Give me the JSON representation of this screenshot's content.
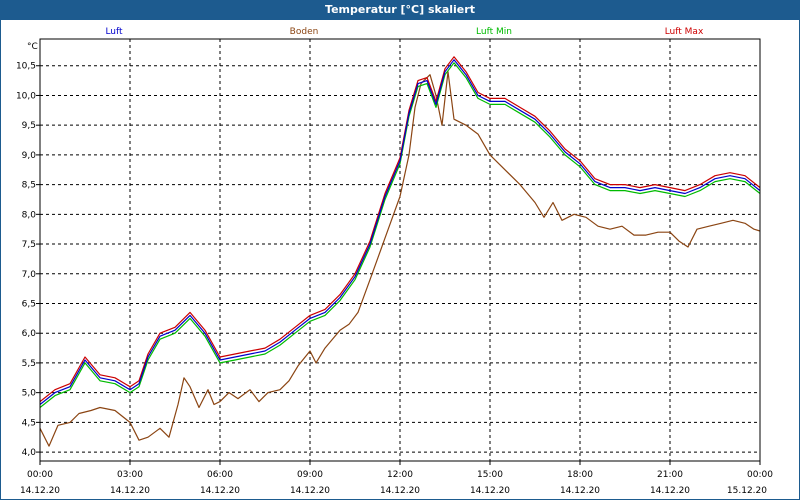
{
  "window": {
    "title": "Temperatur [°C] skaliert"
  },
  "chart_data": {
    "type": "line",
    "title": "Temperatur [°C] skaliert",
    "ylabel": "°C",
    "ylim": [
      3.85,
      10.95
    ],
    "yticks": [
      "4,0",
      "4,5",
      "5,0",
      "5,5",
      "6,0",
      "6,5",
      "7,0",
      "7,5",
      "8,0",
      "8,5",
      "9,0",
      "9,5",
      "10,0",
      "10,5"
    ],
    "xticks": [
      {
        "time": "00:00",
        "date": "14.12.20"
      },
      {
        "time": "03:00",
        "date": "14.12.20"
      },
      {
        "time": "06:00",
        "date": "14.12.20"
      },
      {
        "time": "09:00",
        "date": "14.12.20"
      },
      {
        "time": "12:00",
        "date": "14.12.20"
      },
      {
        "time": "15:00",
        "date": "14.12.20"
      },
      {
        "time": "18:00",
        "date": "14.12.20"
      },
      {
        "time": "21:00",
        "date": "14.12.20"
      },
      {
        "time": "00:00",
        "date": "15.12.20"
      }
    ],
    "xlim_hours": [
      0,
      24
    ],
    "grid": true,
    "legend_position": "top",
    "series": [
      {
        "name": "Luft",
        "color": "#0000cc",
        "points": [
          [
            0,
            4.8
          ],
          [
            0.5,
            5.0
          ],
          [
            1.0,
            5.1
          ],
          [
            1.5,
            5.55
          ],
          [
            2.0,
            5.25
          ],
          [
            2.5,
            5.2
          ],
          [
            3.0,
            5.05
          ],
          [
            3.3,
            5.15
          ],
          [
            3.6,
            5.6
          ],
          [
            4.0,
            5.95
          ],
          [
            4.5,
            6.05
          ],
          [
            5.0,
            6.3
          ],
          [
            5.5,
            6.0
          ],
          [
            6.0,
            5.55
          ],
          [
            6.5,
            5.6
          ],
          [
            7.0,
            5.65
          ],
          [
            7.5,
            5.7
          ],
          [
            8.0,
            5.85
          ],
          [
            8.5,
            6.05
          ],
          [
            9.0,
            6.25
          ],
          [
            9.5,
            6.35
          ],
          [
            10.0,
            6.6
          ],
          [
            10.5,
            6.95
          ],
          [
            11.0,
            7.5
          ],
          [
            11.5,
            8.3
          ],
          [
            12.0,
            8.9
          ],
          [
            12.3,
            9.7
          ],
          [
            12.6,
            10.2
          ],
          [
            12.9,
            10.25
          ],
          [
            13.2,
            9.85
          ],
          [
            13.5,
            10.4
          ],
          [
            13.8,
            10.6
          ],
          [
            14.2,
            10.35
          ],
          [
            14.6,
            10.0
          ],
          [
            15.0,
            9.9
          ],
          [
            15.5,
            9.9
          ],
          [
            16.0,
            9.75
          ],
          [
            16.5,
            9.6
          ],
          [
            17.0,
            9.35
          ],
          [
            17.5,
            9.05
          ],
          [
            18.0,
            8.85
          ],
          [
            18.5,
            8.55
          ],
          [
            19.0,
            8.45
          ],
          [
            19.5,
            8.45
          ],
          [
            20.0,
            8.4
          ],
          [
            20.5,
            8.45
          ],
          [
            21.0,
            8.4
          ],
          [
            21.5,
            8.35
          ],
          [
            22.0,
            8.45
          ],
          [
            22.5,
            8.6
          ],
          [
            23.0,
            8.65
          ],
          [
            23.5,
            8.6
          ],
          [
            24.0,
            8.4
          ]
        ]
      },
      {
        "name": "Boden",
        "color": "#8b4513",
        "points": [
          [
            0,
            4.4
          ],
          [
            0.3,
            4.1
          ],
          [
            0.6,
            4.45
          ],
          [
            1.0,
            4.5
          ],
          [
            1.3,
            4.65
          ],
          [
            1.7,
            4.7
          ],
          [
            2.0,
            4.75
          ],
          [
            2.5,
            4.7
          ],
          [
            3.0,
            4.5
          ],
          [
            3.3,
            4.2
          ],
          [
            3.6,
            4.25
          ],
          [
            4.0,
            4.4
          ],
          [
            4.3,
            4.25
          ],
          [
            4.6,
            4.8
          ],
          [
            4.8,
            5.25
          ],
          [
            5.0,
            5.1
          ],
          [
            5.3,
            4.75
          ],
          [
            5.6,
            5.05
          ],
          [
            5.8,
            4.8
          ],
          [
            6.0,
            4.85
          ],
          [
            6.3,
            5.0
          ],
          [
            6.6,
            4.9
          ],
          [
            7.0,
            5.05
          ],
          [
            7.3,
            4.85
          ],
          [
            7.6,
            5.0
          ],
          [
            8.0,
            5.05
          ],
          [
            8.3,
            5.2
          ],
          [
            8.6,
            5.45
          ],
          [
            9.0,
            5.7
          ],
          [
            9.2,
            5.5
          ],
          [
            9.5,
            5.75
          ],
          [
            10.0,
            6.05
          ],
          [
            10.3,
            6.15
          ],
          [
            10.6,
            6.35
          ],
          [
            11.0,
            6.9
          ],
          [
            11.5,
            7.6
          ],
          [
            12.0,
            8.3
          ],
          [
            12.3,
            9.0
          ],
          [
            12.5,
            9.8
          ],
          [
            12.7,
            10.2
          ],
          [
            13.0,
            10.35
          ],
          [
            13.2,
            10.0
          ],
          [
            13.4,
            9.5
          ],
          [
            13.6,
            10.4
          ],
          [
            13.8,
            9.6
          ],
          [
            14.2,
            9.5
          ],
          [
            14.6,
            9.35
          ],
          [
            15.0,
            9.0
          ],
          [
            15.5,
            8.75
          ],
          [
            16.0,
            8.5
          ],
          [
            16.5,
            8.2
          ],
          [
            16.8,
            7.95
          ],
          [
            17.1,
            8.2
          ],
          [
            17.4,
            7.9
          ],
          [
            17.8,
            8.0
          ],
          [
            18.2,
            7.95
          ],
          [
            18.6,
            7.8
          ],
          [
            19.0,
            7.75
          ],
          [
            19.4,
            7.8
          ],
          [
            19.8,
            7.65
          ],
          [
            20.2,
            7.65
          ],
          [
            20.6,
            7.7
          ],
          [
            21.0,
            7.7
          ],
          [
            21.3,
            7.55
          ],
          [
            21.6,
            7.45
          ],
          [
            21.9,
            7.75
          ],
          [
            22.3,
            7.8
          ],
          [
            22.7,
            7.85
          ],
          [
            23.1,
            7.9
          ],
          [
            23.5,
            7.85
          ],
          [
            23.8,
            7.75
          ],
          [
            24.0,
            7.72
          ]
        ]
      },
      {
        "name": "Luft Min",
        "color": "#00bb00",
        "points": [
          [
            0,
            4.75
          ],
          [
            0.5,
            4.95
          ],
          [
            1.0,
            5.05
          ],
          [
            1.5,
            5.5
          ],
          [
            2.0,
            5.2
          ],
          [
            2.5,
            5.15
          ],
          [
            3.0,
            5.0
          ],
          [
            3.3,
            5.1
          ],
          [
            3.6,
            5.55
          ],
          [
            4.0,
            5.9
          ],
          [
            4.5,
            6.0
          ],
          [
            5.0,
            6.25
          ],
          [
            5.5,
            5.95
          ],
          [
            6.0,
            5.5
          ],
          [
            6.5,
            5.55
          ],
          [
            7.0,
            5.6
          ],
          [
            7.5,
            5.65
          ],
          [
            8.0,
            5.8
          ],
          [
            8.5,
            6.0
          ],
          [
            9.0,
            6.2
          ],
          [
            9.5,
            6.3
          ],
          [
            10.0,
            6.55
          ],
          [
            10.5,
            6.9
          ],
          [
            11.0,
            7.45
          ],
          [
            11.5,
            8.25
          ],
          [
            12.0,
            8.85
          ],
          [
            12.3,
            9.65
          ],
          [
            12.6,
            10.15
          ],
          [
            12.9,
            10.2
          ],
          [
            13.2,
            9.8
          ],
          [
            13.5,
            10.35
          ],
          [
            13.8,
            10.55
          ],
          [
            14.2,
            10.3
          ],
          [
            14.6,
            9.95
          ],
          [
            15.0,
            9.85
          ],
          [
            15.5,
            9.85
          ],
          [
            16.0,
            9.7
          ],
          [
            16.5,
            9.55
          ],
          [
            17.0,
            9.3
          ],
          [
            17.5,
            9.0
          ],
          [
            18.0,
            8.8
          ],
          [
            18.5,
            8.5
          ],
          [
            19.0,
            8.4
          ],
          [
            19.5,
            8.4
          ],
          [
            20.0,
            8.35
          ],
          [
            20.5,
            8.4
          ],
          [
            21.0,
            8.35
          ],
          [
            21.5,
            8.3
          ],
          [
            22.0,
            8.4
          ],
          [
            22.5,
            8.55
          ],
          [
            23.0,
            8.6
          ],
          [
            23.5,
            8.55
          ],
          [
            24.0,
            8.35
          ]
        ]
      },
      {
        "name": "Luft Max",
        "color": "#cc0000",
        "points": [
          [
            0,
            4.85
          ],
          [
            0.5,
            5.05
          ],
          [
            1.0,
            5.15
          ],
          [
            1.5,
            5.6
          ],
          [
            2.0,
            5.3
          ],
          [
            2.5,
            5.25
          ],
          [
            3.0,
            5.1
          ],
          [
            3.3,
            5.2
          ],
          [
            3.6,
            5.65
          ],
          [
            4.0,
            6.0
          ],
          [
            4.5,
            6.1
          ],
          [
            5.0,
            6.35
          ],
          [
            5.5,
            6.05
          ],
          [
            6.0,
            5.6
          ],
          [
            6.5,
            5.65
          ],
          [
            7.0,
            5.7
          ],
          [
            7.5,
            5.75
          ],
          [
            8.0,
            5.9
          ],
          [
            8.5,
            6.1
          ],
          [
            9.0,
            6.3
          ],
          [
            9.5,
            6.4
          ],
          [
            10.0,
            6.65
          ],
          [
            10.5,
            7.0
          ],
          [
            11.0,
            7.55
          ],
          [
            11.5,
            8.35
          ],
          [
            12.0,
            8.95
          ],
          [
            12.3,
            9.75
          ],
          [
            12.6,
            10.25
          ],
          [
            12.9,
            10.3
          ],
          [
            13.2,
            9.9
          ],
          [
            13.5,
            10.45
          ],
          [
            13.8,
            10.65
          ],
          [
            14.2,
            10.4
          ],
          [
            14.6,
            10.05
          ],
          [
            15.0,
            9.95
          ],
          [
            15.5,
            9.95
          ],
          [
            16.0,
            9.8
          ],
          [
            16.5,
            9.65
          ],
          [
            17.0,
            9.4
          ],
          [
            17.5,
            9.1
          ],
          [
            18.0,
            8.9
          ],
          [
            18.5,
            8.6
          ],
          [
            19.0,
            8.5
          ],
          [
            19.5,
            8.5
          ],
          [
            20.0,
            8.45
          ],
          [
            20.5,
            8.5
          ],
          [
            21.0,
            8.45
          ],
          [
            21.5,
            8.4
          ],
          [
            22.0,
            8.5
          ],
          [
            22.5,
            8.65
          ],
          [
            23.0,
            8.7
          ],
          [
            23.5,
            8.65
          ],
          [
            24.0,
            8.45
          ]
        ]
      }
    ]
  }
}
